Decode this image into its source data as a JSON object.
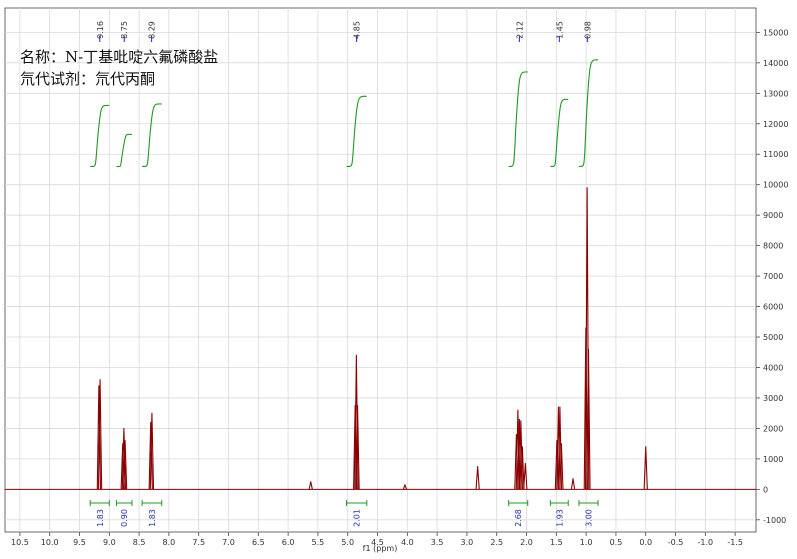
{
  "sample": {
    "name_line": "名称：N-丁基吡啶六氟磷酸盐",
    "solvent_line": "氘代试剂：氘代丙酮"
  },
  "chart_data": {
    "type": "line",
    "title": "",
    "xlabel": "f1 (ppm)",
    "ylabel": "",
    "x_reversed": true,
    "xlim": [
      10.75,
      -1.85
    ],
    "ylim": [
      -1400,
      15800
    ],
    "grid": true,
    "x_ticks": [
      10.5,
      10.0,
      9.5,
      9.0,
      8.5,
      8.0,
      7.5,
      7.0,
      6.5,
      6.0,
      5.5,
      5.0,
      4.5,
      4.0,
      3.5,
      3.0,
      2.5,
      2.0,
      1.5,
      1.0,
      0.5,
      0.0,
      -0.5,
      -1.0,
      -1.5
    ],
    "x_tick_labels": [
      "10.5",
      "10.0",
      "9.5",
      "9.0",
      "8.5",
      "8.0",
      "7.5",
      "7.0",
      "6.5",
      "6.0",
      "5.5",
      "5.0",
      "4.5",
      "4.0",
      "3.5",
      "3.0",
      "2.5",
      "2.0",
      "1.5",
      "1.0",
      "0.5",
      "0.0",
      "-0.5",
      "-1.0",
      "-1.5"
    ],
    "y_ticks": [
      -1000,
      0,
      1000,
      2000,
      3000,
      4000,
      5000,
      6000,
      7000,
      8000,
      9000,
      10000,
      11000,
      12000,
      13000,
      14000,
      15000
    ],
    "y_tick_labels": [
      "-1000",
      "0",
      "1000",
      "2000",
      "3000",
      "4000",
      "5000",
      "6000",
      "7000",
      "8000",
      "9000",
      "10000",
      "11000",
      "12000",
      "13000",
      "14000",
      "15000"
    ],
    "spectrum_color": "#8b0000",
    "peaks": [
      {
        "x": 9.175,
        "y": 3400
      },
      {
        "x": 9.155,
        "y": 3600
      },
      {
        "x": 8.775,
        "y": 1500
      },
      {
        "x": 8.755,
        "y": 2000
      },
      {
        "x": 8.735,
        "y": 1600
      },
      {
        "x": 8.305,
        "y": 2200
      },
      {
        "x": 8.285,
        "y": 2500
      },
      {
        "x": 5.62,
        "y": 250
      },
      {
        "x": 4.875,
        "y": 2750
      },
      {
        "x": 4.855,
        "y": 4400
      },
      {
        "x": 4.835,
        "y": 2750
      },
      {
        "x": 4.04,
        "y": 150
      },
      {
        "x": 2.82,
        "y": 750
      },
      {
        "x": 2.17,
        "y": 1800
      },
      {
        "x": 2.145,
        "y": 2600
      },
      {
        "x": 2.12,
        "y": 2300
      },
      {
        "x": 2.095,
        "y": 2250
      },
      {
        "x": 2.07,
        "y": 1400
      },
      {
        "x": 2.02,
        "y": 850
      },
      {
        "x": 1.49,
        "y": 1600
      },
      {
        "x": 1.465,
        "y": 2700
      },
      {
        "x": 1.44,
        "y": 2700
      },
      {
        "x": 1.415,
        "y": 1500
      },
      {
        "x": 1.22,
        "y": 350
      },
      {
        "x": 1.005,
        "y": 5300
      },
      {
        "x": 0.983,
        "y": 9900
      },
      {
        "x": 0.961,
        "y": 4600
      },
      {
        "x": 0.0,
        "y": 1400
      }
    ],
    "peak_labels": [
      {
        "x": 9.16,
        "label": "9.16"
      },
      {
        "x": 8.75,
        "label": "8.75"
      },
      {
        "x": 8.29,
        "label": "8.29"
      },
      {
        "x": 4.85,
        "label": "4.85"
      },
      {
        "x": 2.12,
        "label": "2.12"
      },
      {
        "x": 1.45,
        "label": "1.45"
      },
      {
        "x": 0.98,
        "label": "0.98"
      }
    ],
    "integrals": [
      {
        "from": 9.32,
        "to": 9.0,
        "label": "1.83",
        "curve_start": 10600,
        "curve_rise": 2000
      },
      {
        "from": 8.88,
        "to": 8.62,
        "label": "0.90",
        "curve_start": 10600,
        "curve_rise": 1050
      },
      {
        "from": 8.45,
        "to": 8.12,
        "label": "1.83",
        "curve_start": 10600,
        "curve_rise": 2050
      },
      {
        "from": 5.02,
        "to": 4.68,
        "label": "2.01",
        "curve_start": 10600,
        "curve_rise": 2300
      },
      {
        "from": 2.3,
        "to": 1.98,
        "label": "2.68",
        "curve_start": 10600,
        "curve_rise": 3100
      },
      {
        "from": 1.6,
        "to": 1.3,
        "label": "1.93",
        "curve_start": 10600,
        "curve_rise": 2200
      },
      {
        "from": 1.12,
        "to": 0.8,
        "label": "3.00",
        "curve_start": 10600,
        "curve_rise": 3500
      }
    ]
  }
}
